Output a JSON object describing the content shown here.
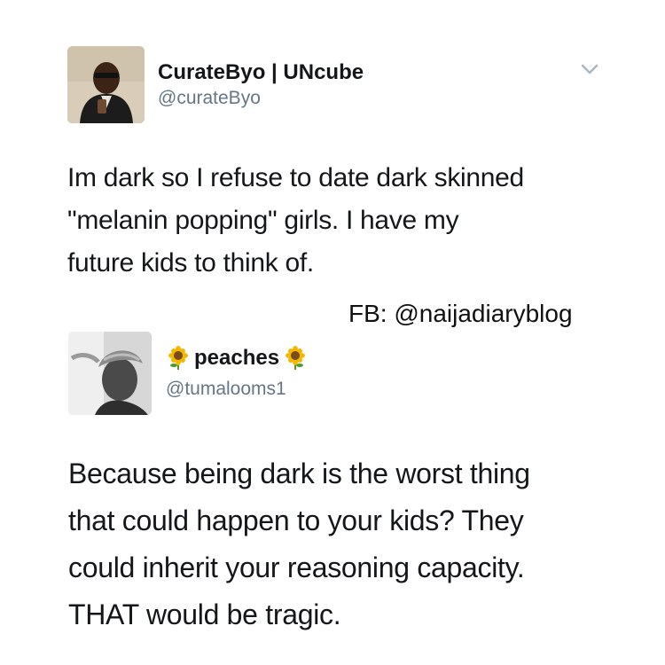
{
  "tweet_1": {
    "display_name": "CurateByo | UNcube",
    "handle": "@curateByo",
    "text_lines": [
      "Im dark so I refuse to date dark skinned",
      "\"melanin popping\" girls. I have my",
      "future kids to think of."
    ],
    "menu_icon": "chevron-down-icon"
  },
  "watermark": "FB: @naijadiaryblog",
  "tweet_2": {
    "display_name": "peaches",
    "handle": "@tumalooms1",
    "name_emoji": "sunflower",
    "text_lines": [
      "Because being dark is the worst thing",
      "that could happen to your kids? They",
      "could inherit your reasoning capacity.",
      "THAT would be tragic."
    ]
  },
  "colors": {
    "text": "#14171a",
    "handle": "#657786",
    "chevron": "#aab8c2",
    "sunflower_petal": "#f5b800",
    "sunflower_center": "#7a4a1c",
    "stem": "#4e9a2f"
  }
}
